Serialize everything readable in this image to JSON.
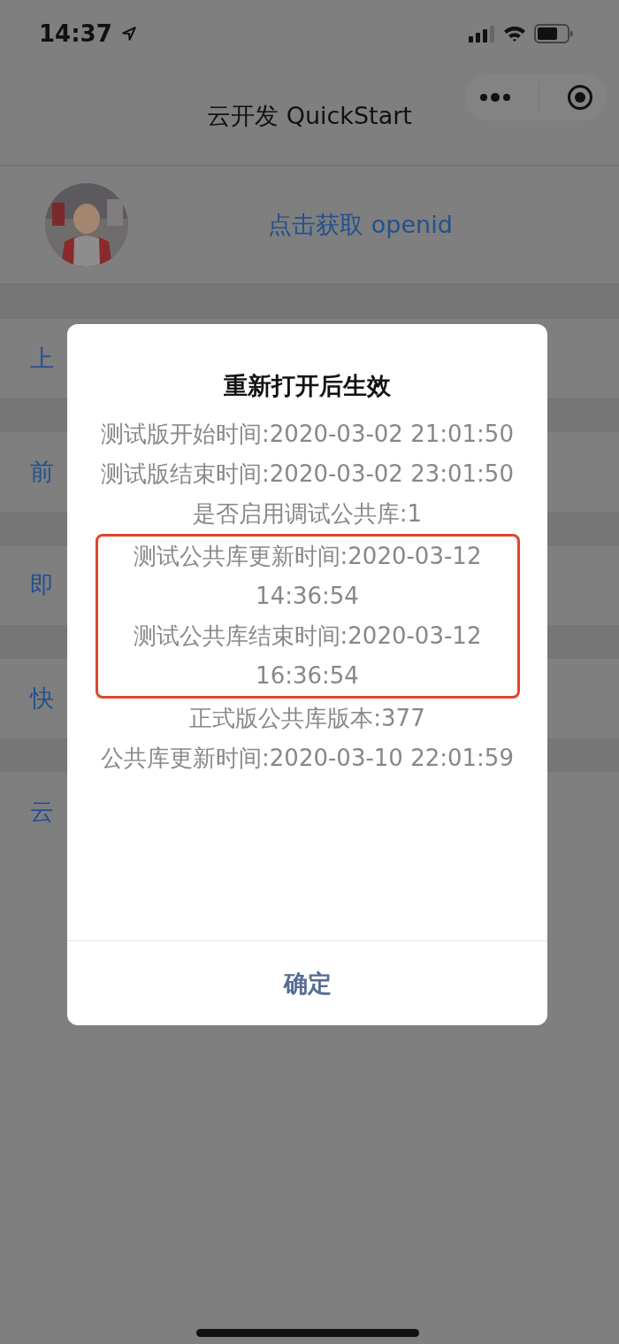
{
  "status_bar": {
    "time": "14:37"
  },
  "nav": {
    "title": "云开发 QuickStart"
  },
  "user": {
    "button": "点击获取 openid"
  },
  "list_items": [
    {
      "label": "上"
    },
    {
      "label": "前"
    },
    {
      "label": "即"
    },
    {
      "label": "快"
    },
    {
      "label": "云"
    }
  ],
  "dialog": {
    "title": "重新打开后生效",
    "groups": [
      {
        "highlighted": false,
        "lines": [
          "测试版开始时间:2020-03-02 21:01:50",
          "测试版结束时间:2020-03-02 23:01:50",
          "是否启用调试公共库:1"
        ]
      },
      {
        "highlighted": true,
        "lines": [
          "测试公共库更新时间:2020-03-12 14:36:54",
          "测试公共库结束时间:2020-03-12 16:36:54"
        ]
      },
      {
        "highlighted": false,
        "lines": [
          "正式版公共库版本:377",
          "公共库更新时间:2020-03-10 22:01:59"
        ]
      }
    ],
    "confirm": "确定"
  }
}
